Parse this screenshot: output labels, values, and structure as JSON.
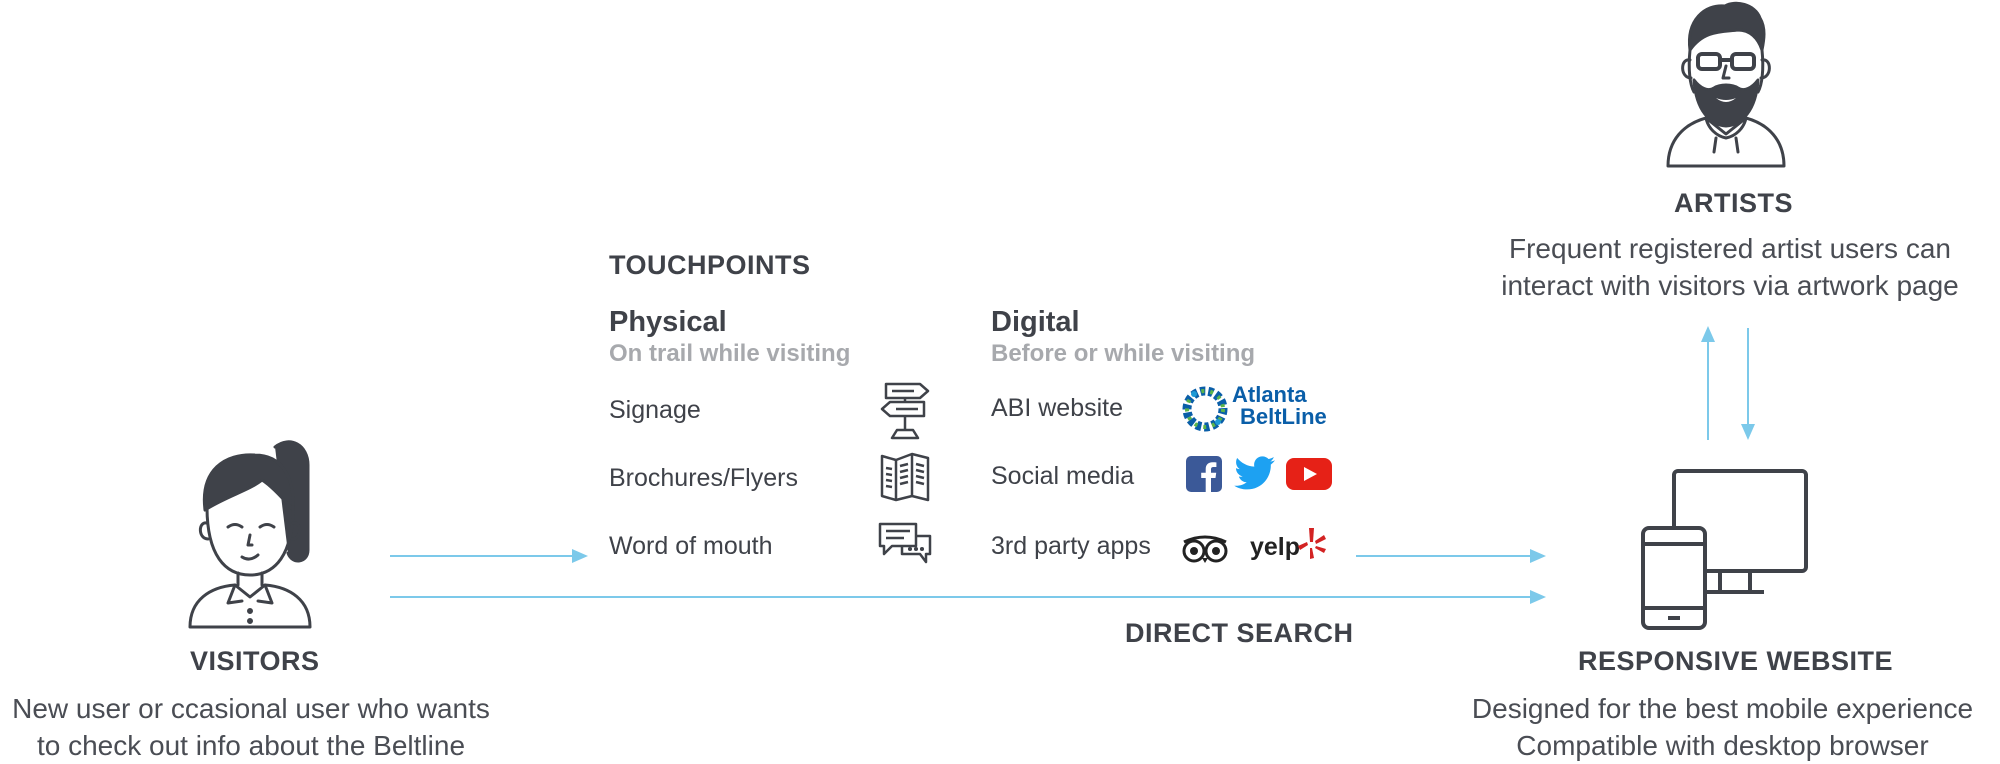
{
  "visitors": {
    "heading": "VISITORS",
    "description_line1": "New user or ccasional user who wants",
    "description_line2": "to check out info about the Beltline"
  },
  "touchpoints": {
    "heading": "TOUCHPOINTS",
    "physical": {
      "title": "Physical",
      "subtitle": "On trail while visiting",
      "items": [
        {
          "label": "Signage",
          "icon": "signpost-icon"
        },
        {
          "label": "Brochures/Flyers",
          "icon": "brochure-icon"
        },
        {
          "label": "Word of mouth",
          "icon": "chat-bubbles-icon"
        }
      ]
    },
    "digital": {
      "title": "Digital",
      "subtitle": "Before or while visiting",
      "items": [
        {
          "label": "ABI website",
          "icon": "atlanta-beltline-logo",
          "logo_text_1": "Atlanta",
          "logo_text_2": "BeltLine"
        },
        {
          "label": "Social media",
          "icons": [
            "facebook-icon",
            "twitter-icon",
            "youtube-icon"
          ]
        },
        {
          "label": "3rd party apps",
          "icons": [
            "tripadvisor-icon",
            "yelp-logo"
          ],
          "yelp_text": "yelp"
        }
      ]
    }
  },
  "direct_search": {
    "label": "DIRECT SEARCH"
  },
  "website": {
    "heading": "RESPONSIVE WEBSITE",
    "description_line1": "Designed for the best mobile experience",
    "description_line2": "Compatible with desktop browser"
  },
  "artists": {
    "heading": "ARTISTS",
    "description_line1": "Frequent registered artist users can",
    "description_line2": "interact with visitors via artwork page"
  },
  "colors": {
    "arrow": "#7cc9ea",
    "text_dark": "#3f4249",
    "text_muted": "#a7a9ad",
    "icon_stroke": "#3f4249",
    "facebook": "#3b5998",
    "twitter": "#1da1f2",
    "youtube": "#e62117",
    "yelp_red": "#d32323",
    "beltline_blue": "#0a5ea8",
    "beltline_green": "#5bb44a"
  }
}
